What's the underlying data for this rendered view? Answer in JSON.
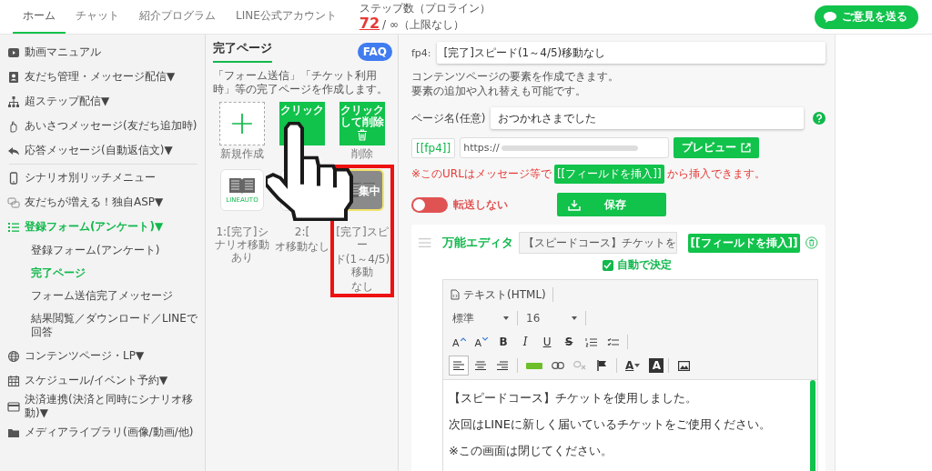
{
  "nav": {
    "tabs": [
      {
        "label": "ホーム",
        "selected": true
      },
      {
        "label": "チャット",
        "selected": false
      },
      {
        "label": "紹介プログラム",
        "selected": false
      },
      {
        "label": "LINE公式アカウント",
        "selected": false
      }
    ],
    "step_count": {
      "label": "ステップ数（プロライン）",
      "value": "72",
      "limit": "/ ∞（上限なし）"
    },
    "feedback_button": "ご意見を送る"
  },
  "sidebar": {
    "groups": [
      [
        {
          "label": "動画マニュアル",
          "selected": false
        },
        {
          "label": "友だち管理・メッセージ配信",
          "caret": "▼",
          "selected": false
        },
        {
          "label": "超ステップ配信",
          "caret": "▼",
          "selected": false
        },
        {
          "label": "あいさつメッセージ",
          "note": "(友だち追加時)",
          "selected": false
        },
        {
          "label": "応答メッセージ",
          "note": "(自動返信文)",
          "caret": "▼",
          "selected": false
        }
      ],
      [
        {
          "label": "シナリオ別リッチメニュー",
          "selected": false
        },
        {
          "label": "友だちが増える！独自ASP",
          "caret": "▼",
          "selected": false
        },
        {
          "label": "登録フォーム",
          "note": "(アンケート)",
          "caret": "▼",
          "selected": true,
          "children": [
            {
              "label": "登録フォーム",
              "note": "(アンケート)",
              "selected": false
            },
            {
              "label": "完了ページ",
              "selected": true
            },
            {
              "label": "フォーム送信完了メッセージ",
              "selected": false
            },
            {
              "label": "結果閲覧／ダウンロード／LINEで回答",
              "selected": false
            }
          ]
        },
        {
          "label": "コンテンツページ・LP",
          "caret": "▼",
          "selected": false
        },
        {
          "label": "スケジュール/イベント予約",
          "caret": "▼",
          "selected": false
        },
        {
          "label": "決済連携",
          "note": "(決済と同時にシナリオ移動)",
          "caret": "▼",
          "selected": false
        },
        {
          "label": "メディアライブラリ",
          "note": "(画像/動画/他)",
          "selected": false
        }
      ]
    ]
  },
  "panel": {
    "title": "完了ページ",
    "faq": "FAQ",
    "description": "「フォーム送信」「チケット利用時」等の完了ページを作成します。",
    "actions": [
      {
        "kind": "new",
        "label": "新規作成"
      },
      {
        "kind": "copy",
        "text": "クリック"
      },
      {
        "kind": "delete",
        "text": "クリックして削除",
        "label": "削除"
      }
    ],
    "pages": [
      {
        "name": [
          "1:[完了]シナリオ移動あり"
        ],
        "logo": "LINEAUTO",
        "selected": false
      },
      {
        "name": [
          "2:[",
          "オ移動なし"
        ],
        "selected": false
      },
      {
        "name": [
          "[完了]スピー",
          "ド(1～4/5)移動",
          "なし"
        ],
        "selected": true,
        "badge": "集中"
      }
    ]
  },
  "editor": {
    "fp_label": "fp4:",
    "title_value": "[完了]スピード(1～4/5)移動なし",
    "description": [
      "コンテンツページの要素を作成できます。",
      "要素の追加や入れ替えも可能です。"
    ],
    "page_name": {
      "label": "ページ名(任意)",
      "value": "おつかれさまでした"
    },
    "url": {
      "tag": "[[fp4]]",
      "value": "https://",
      "preview": "プレビュー"
    },
    "notice": {
      "before": "※このURLはメッセージ等で",
      "tag": "[[フィールドを挿入]]",
      "after": "から挿入できます。"
    },
    "forward": {
      "on": false,
      "label": "転送しない"
    },
    "save": "保存",
    "block": {
      "title": "万能エディタ",
      "select_value": "【スピードコース】チケットを",
      "insert_button": "[[フィールドを挿入]]",
      "auto": {
        "checked": true,
        "label": "自動で決定"
      },
      "mode": "テキスト(HTML)",
      "style_select": "標準",
      "size_select": "16",
      "format_tools": [
        {
          "kind": "grow",
          "label": "A"
        },
        {
          "kind": "shrink",
          "label": "A"
        },
        {
          "kind": "bold",
          "label": "B"
        },
        {
          "kind": "italic",
          "label": "I"
        },
        {
          "kind": "underline",
          "label": "U"
        },
        {
          "kind": "strike",
          "label": "S"
        },
        {
          "kind": "ordered-list"
        },
        {
          "kind": "check-list"
        }
      ],
      "align": [
        {
          "kind": "left",
          "selected": true
        },
        {
          "kind": "center",
          "selected": false
        },
        {
          "kind": "right",
          "selected": false
        }
      ],
      "insert_tools": [
        {
          "kind": "marker"
        },
        {
          "kind": "link"
        },
        {
          "kind": "unlink"
        },
        {
          "kind": "flag"
        },
        {
          "kind": "text-color",
          "label": "A"
        },
        {
          "kind": "back-color",
          "label": "A"
        },
        {
          "kind": "image"
        }
      ],
      "content": [
        "【スピードコース】チケットを使用しました。",
        "次回はLINEに新しく届いているチケットをご使用ください。",
        "※この画面は閉じてください。"
      ]
    }
  }
}
